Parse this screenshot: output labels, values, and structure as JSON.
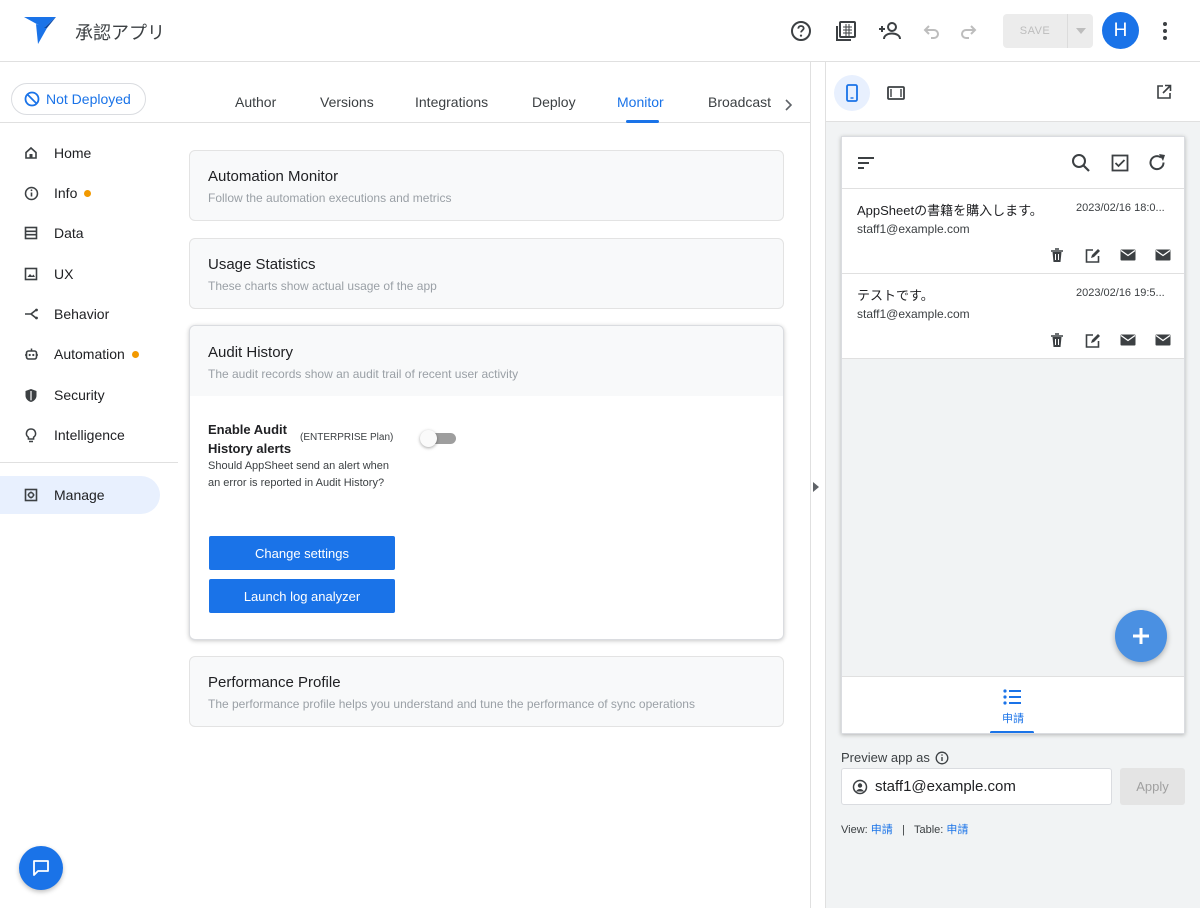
{
  "header": {
    "app_title": "承認アプリ",
    "save_label": "SAVE",
    "avatar_initial": "H"
  },
  "sidebar": {
    "deploy_status": "Not Deployed",
    "items": [
      {
        "label": "Home",
        "icon": "home-icon"
      },
      {
        "label": "Info",
        "icon": "info-icon",
        "dot": true
      },
      {
        "label": "Data",
        "icon": "data-icon"
      },
      {
        "label": "UX",
        "icon": "ux-icon"
      },
      {
        "label": "Behavior",
        "icon": "behavior-icon"
      },
      {
        "label": "Automation",
        "icon": "automation-icon",
        "dot": true
      },
      {
        "label": "Security",
        "icon": "shield-icon"
      },
      {
        "label": "Intelligence",
        "icon": "lightbulb-icon"
      },
      {
        "label": "Manage",
        "icon": "manage-icon",
        "active": true
      }
    ]
  },
  "tabs": {
    "items": [
      "Author",
      "Versions",
      "Integrations",
      "Deploy",
      "Monitor",
      "Broadcast"
    ],
    "active": "Monitor"
  },
  "cards": {
    "automation_monitor": {
      "title": "Automation Monitor",
      "subtitle": "Follow the automation executions and metrics"
    },
    "usage_statistics": {
      "title": "Usage Statistics",
      "subtitle": "These charts show actual usage of the app"
    },
    "audit_history": {
      "title": "Audit History",
      "subtitle": "The audit records show an audit trail of recent user activity",
      "enable_label": "Enable Audit History alerts",
      "plan": "(ENTERPRISE Plan)",
      "alerts_enabled": false,
      "description": "Should AppSheet send an alert when an error is reported in Audit History?",
      "change_settings": "Change settings",
      "launch_log": "Launch log analyzer"
    },
    "performance_profile": {
      "title": "Performance Profile",
      "subtitle": "The performance profile helps you understand and tune the performance of sync operations"
    }
  },
  "preview": {
    "rows": [
      {
        "title": "AppSheetの書籍を購入します。",
        "date": "2023/02/16 18:0...",
        "email": "staff1@example.com"
      },
      {
        "title": "テストです。",
        "date": "2023/02/16 19:5...",
        "email": "staff1@example.com"
      }
    ],
    "bottom_tab": "申請",
    "preview_as_label": "Preview app as",
    "preview_as_value": "staff1@example.com",
    "apply_label": "Apply",
    "view_label": "View:",
    "view_value": "申請",
    "separator": "|",
    "table_label": "Table:",
    "table_value": "申請"
  },
  "colors": {
    "accent": "#1a73e8",
    "dot": "#f29900",
    "fab": "#4a90e2"
  }
}
